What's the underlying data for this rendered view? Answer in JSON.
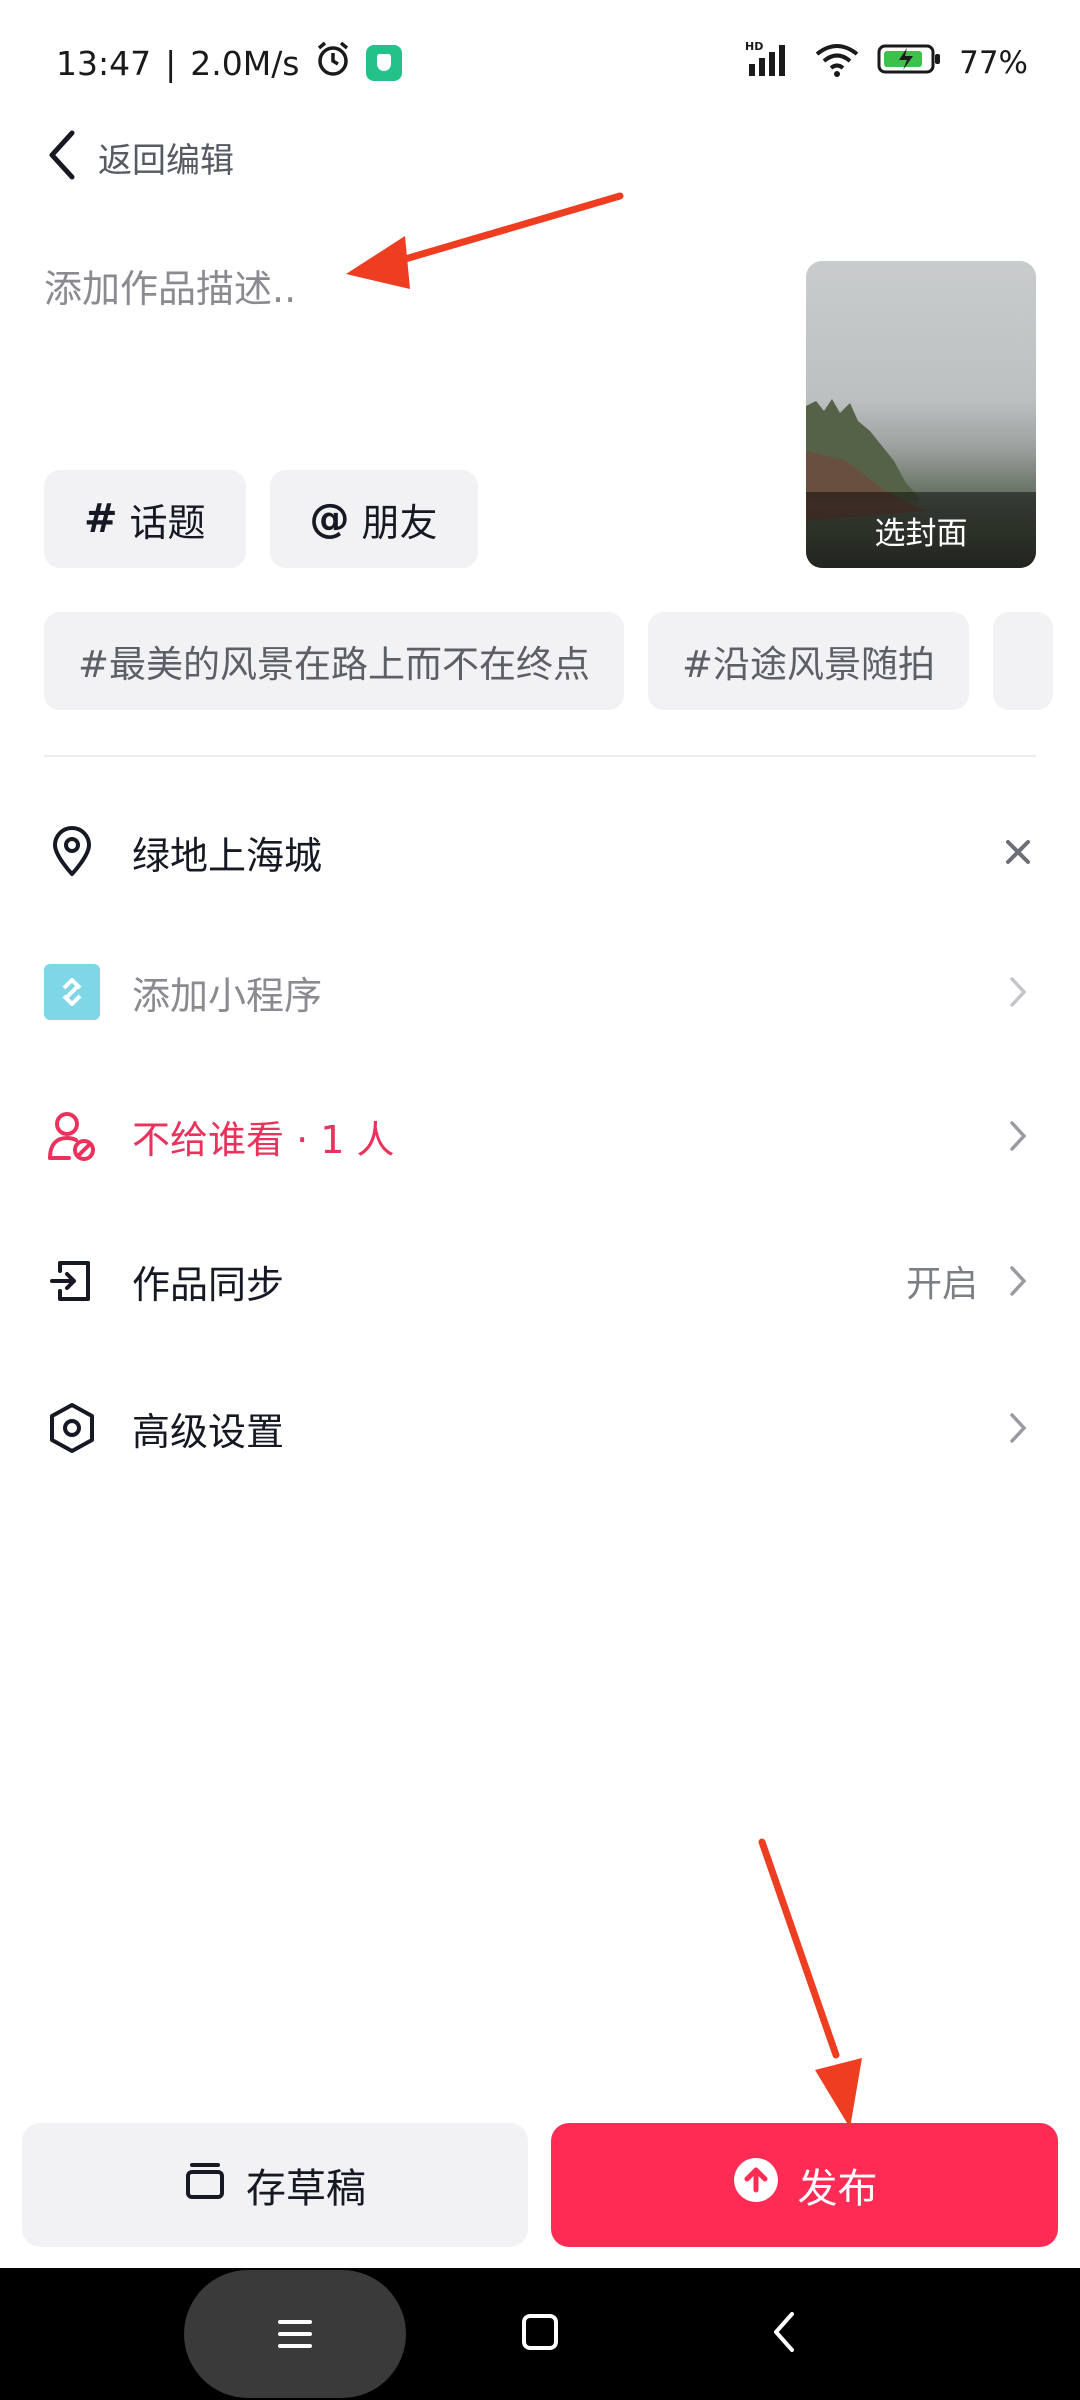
{
  "status_bar": {
    "time": "13:47",
    "net_speed": "2.0M/s",
    "battery": "77%",
    "hd_label": "HD"
  },
  "header": {
    "back_label": "返回编辑"
  },
  "description": {
    "placeholder": "添加作品描述.."
  },
  "cover": {
    "label": "选封面"
  },
  "chips": {
    "topic": {
      "symbol": "#",
      "label": "话题"
    },
    "friend": {
      "symbol": "@",
      "label": "朋友"
    }
  },
  "suggested_tags": [
    "#最美的风景在路上而不在终点",
    "#沿途风景随拍"
  ],
  "rows": {
    "location": {
      "label": "绿地上海城"
    },
    "mini_program": {
      "label": "添加小程序"
    },
    "privacy": {
      "label": "不给谁看 · 1 人"
    },
    "sync": {
      "label": "作品同步",
      "value": "开启"
    },
    "advanced": {
      "label": "高级设置"
    }
  },
  "actions": {
    "draft": "存草稿",
    "publish": "发布"
  },
  "colors": {
    "accent": "#fe2c55",
    "privacy_text": "#e9335d",
    "mini_program_icon": "#7fd6e6",
    "annotation_arrow": "#ee3d21"
  }
}
